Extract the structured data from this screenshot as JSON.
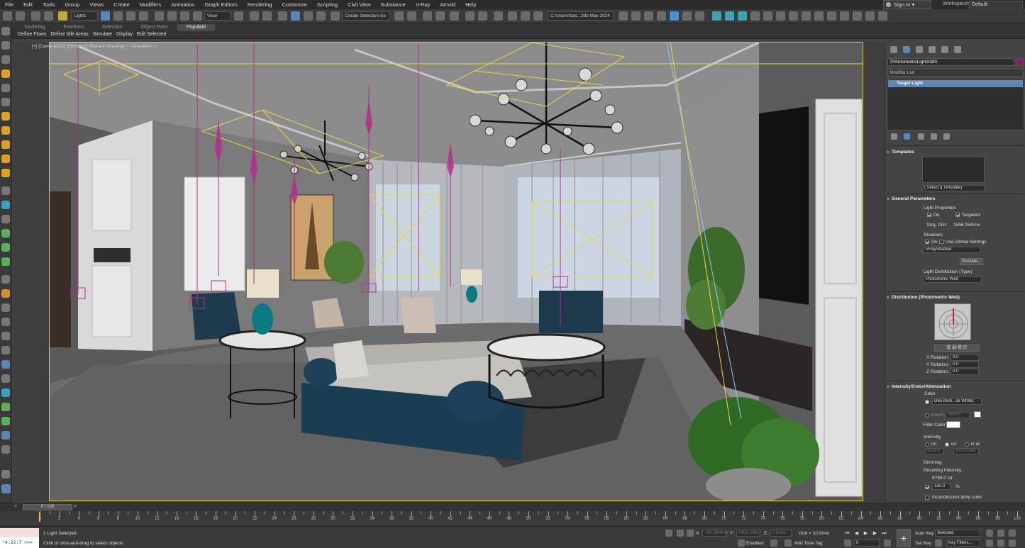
{
  "menu": [
    "File",
    "Edit",
    "Tools",
    "Group",
    "Views",
    "Create",
    "Modifiers",
    "Animation",
    "Graph Editors",
    "Rendering",
    "Customize",
    "Scripting",
    "Civil View",
    "Substance",
    "V-Ray",
    "Arnold",
    "Help"
  ],
  "account": {
    "sign_in": "Sign In",
    "workspaces_label": "Workspaces:",
    "workspace": "Default"
  },
  "toolbar": {
    "selection_filter": "Lights",
    "ref_coord": "View",
    "named_selection": "Create Selection Se",
    "project_path": "C:\\Users\\bas...3ds Max 2024"
  },
  "ribbon": {
    "tabs": [
      "Modeling",
      "Freeform",
      "Selection",
      "Object Paint",
      "Populate"
    ],
    "active_tab": "Populate",
    "buttons": [
      "Define Flows",
      "Define Idle Areas",
      "Simulate",
      "Display",
      "Edit Selected"
    ]
  },
  "viewport": {
    "label": "[+] [Camera002] [Standard] [Default Shading] < <Disabled> >"
  },
  "command_panel": {
    "object_name": "TPhotometricLight2380",
    "object_color": "#8a1a6e",
    "modifier_list": "Modifier List",
    "stack_item": "Target Light",
    "templates": {
      "title": "Templates",
      "select": "( Select a Template)"
    },
    "general": {
      "title": "General Parameters",
      "light_properties": "Light Properties",
      "on": "On",
      "targeted": "Targeted",
      "targ_dist_label": "Targ. Dist:",
      "targ_dist": "1556.254mm",
      "shadows": "Shadows",
      "shadows_on": "On",
      "use_global": "Use Global Settings",
      "shadow_type": "VRayShadow",
      "exclude": "Exclude...",
      "light_dist_label": "Light Distribution (Type)",
      "light_dist": "Photometric Web"
    },
    "distribution": {
      "title": "Distribution (Photometric Web)",
      "file_button": "蓝  弱  筒  灯",
      "x_rot_label": "X Rotation:",
      "x_rot": "0.0",
      "y_rot_label": "Y Rotation:",
      "y_rot": "0.0",
      "z_rot_label": "Z Rotation:",
      "z_rot": "0.0"
    },
    "intensity": {
      "title": "Intensity/Color/Attenuation",
      "color_label": "Color",
      "preset": "D65 Illum...ce White)",
      "kelvin_label": "Kelvin:",
      "kelvin": "3600.0",
      "filter_color_label": "Filter Color:",
      "intensity_label": "Intensity",
      "units": [
        "lm",
        "cd",
        "lx at"
      ],
      "lm_value": "6526.0",
      "lx_value": "1000.0mm",
      "dimming_label": "Dimming",
      "resulting_label": "Resulting Intensity:",
      "resulting": "9789.0 cd",
      "percent": "150.0",
      "percent_unit": "%",
      "incandescent": "Incandescent lamp color"
    }
  },
  "timeline": {
    "frame": "0 / 100",
    "tick_labels": [
      "0",
      "2",
      "4",
      "6",
      "8",
      "10",
      "12",
      "14",
      "16",
      "18",
      "20",
      "22",
      "24",
      "26",
      "28",
      "30",
      "32",
      "34",
      "36",
      "38",
      "40",
      "42",
      "44",
      "46",
      "48",
      "50",
      "52",
      "54",
      "56",
      "58",
      "60",
      "62",
      "64",
      "66",
      "68",
      "70",
      "72",
      "74",
      "76",
      "78",
      "80",
      "82",
      "84",
      "86",
      "88",
      "90",
      "92",
      "94",
      "96",
      "98",
      "100"
    ]
  },
  "status": {
    "maxscript": "\"4:22:7 >>>",
    "selected": "1 Light Selected",
    "prompt": "Click or click-and-drag to select objects",
    "x_label": "X:",
    "x": "-637.994mm",
    "y_label": "Y:",
    "y": "2495.109m",
    "z_label": "Z:",
    "z": "0.0mm",
    "grid": "Grid = 10.0mm",
    "enabled": "Enabled:",
    "add_time_tag": "Add Time Tag",
    "auto_key": "Auto Key",
    "set_key": "Set Key",
    "key_mode": "Selected",
    "key_filters": "Key Filters...",
    "current_frame": "0"
  }
}
